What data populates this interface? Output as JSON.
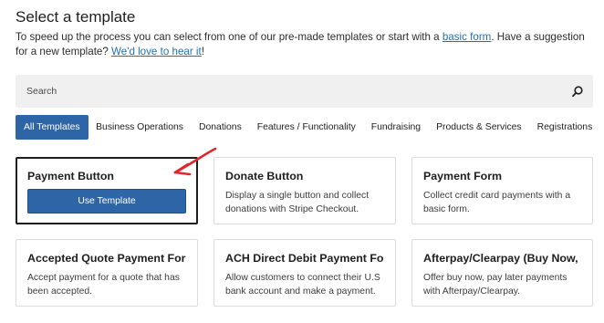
{
  "header": {
    "title": "Select a template",
    "intro_before": "To speed up the process you can select from one of our pre-made templates or start with a ",
    "basic_form_link": "basic form",
    "intro_middle": ". Have a suggestion for a new template? ",
    "suggestion_link": "We'd love to hear it",
    "intro_after": "!"
  },
  "search": {
    "placeholder": "Search",
    "icon": "search-icon"
  },
  "tabs": [
    {
      "label": "All Templates",
      "active": true
    },
    {
      "label": "Business Operations",
      "active": false
    },
    {
      "label": "Donations",
      "active": false
    },
    {
      "label": "Features / Functionality",
      "active": false
    },
    {
      "label": "Fundraising",
      "active": false
    },
    {
      "label": "Products & Services",
      "active": false
    },
    {
      "label": "Registrations",
      "active": false
    }
  ],
  "templates": [
    {
      "title": "Payment Button",
      "button": "Use Template",
      "selected": true
    },
    {
      "title": "Donate Button",
      "description": "Display a single button and collect donations with Stripe Checkout."
    },
    {
      "title": "Payment Form",
      "description": "Collect credit card payments with a basic form."
    },
    {
      "title": "Accepted Quote Payment Form",
      "description": "Accept payment for a quote that has been accepted."
    },
    {
      "title": "ACH Direct Debit Payment Form",
      "description": "Allow customers to connect their U.S bank account and make a payment."
    },
    {
      "title": "Afterpay/Clearpay (Buy Now, ...",
      "description": "Offer buy now, pay later payments with Afterpay/Clearpay."
    }
  ],
  "colors": {
    "accent": "#2e65a6",
    "link": "#2271b1",
    "annotation_arrow": "#e0262c"
  }
}
